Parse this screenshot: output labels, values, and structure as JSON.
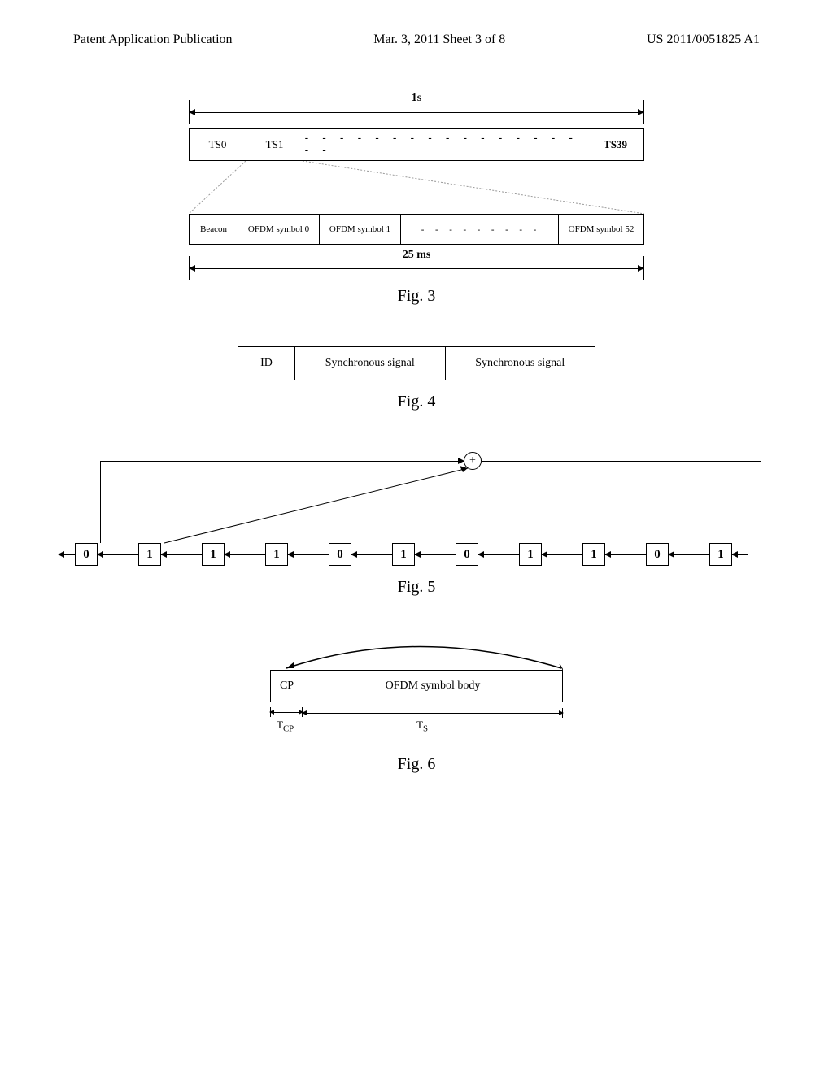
{
  "header": {
    "left": "Patent Application Publication",
    "center": "Mar. 3, 2011  Sheet 3 of 8",
    "right": "US 2011/0051825 A1"
  },
  "fig3": {
    "top_label": "1s",
    "row1": {
      "c0": "TS0",
      "c1": "TS1",
      "dash": "- - - - - - - - - - - - - - - - - -",
      "c39": "TS39"
    },
    "row2": {
      "beacon": "Beacon",
      "s0": "OFDM symbol 0",
      "s1": "OFDM symbol 1",
      "dash": "- - - - - - - - -",
      "s52": "OFDM symbol 52"
    },
    "bottom_label": "25 ms",
    "caption": "Fig. 3"
  },
  "fig4": {
    "c0": "ID",
    "c1": "Synchronous signal",
    "c2": "Synchronous signal",
    "caption": "Fig. 4"
  },
  "fig5": {
    "plus": "+",
    "bits": [
      "0",
      "1",
      "1",
      "1",
      "0",
      "1",
      "0",
      "1",
      "1",
      "0",
      "1"
    ],
    "caption": "Fig. 5"
  },
  "fig6": {
    "cp": "CP",
    "body": "OFDM symbol body",
    "tcp": "T",
    "tcp_sub": "CP",
    "ts": "T",
    "ts_sub": "S",
    "caption": "Fig. 6"
  }
}
